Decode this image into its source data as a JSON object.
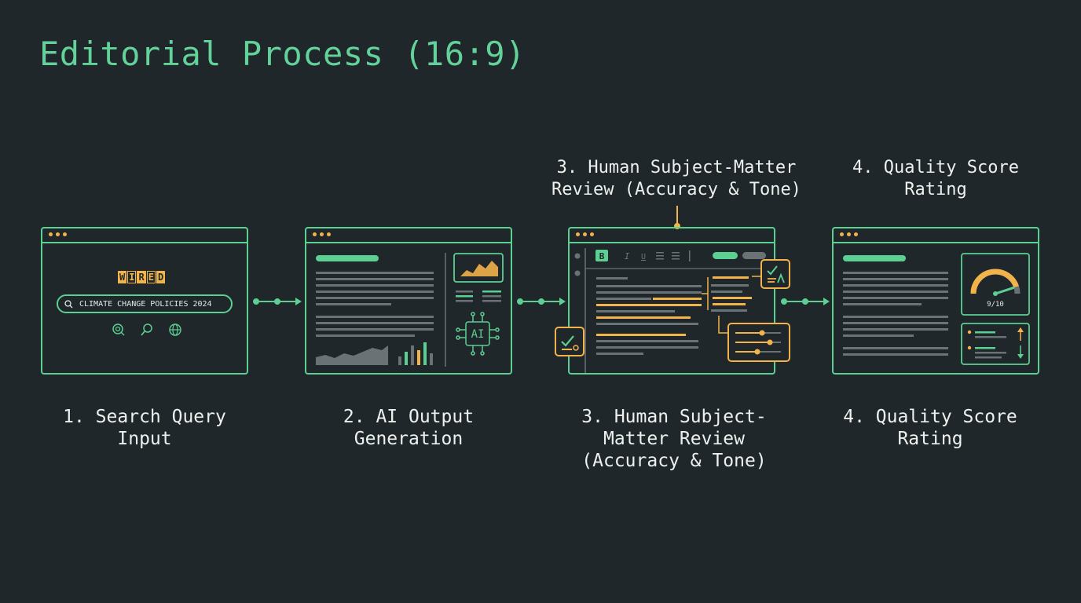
{
  "title": "Editorial Process (16:9)",
  "top_labels": {
    "step3": [
      "3. Human Subject-Matter",
      "Review (Accuracy & Tone)"
    ],
    "step4": [
      "4. Quality Score",
      "Rating"
    ]
  },
  "steps": [
    {
      "lines": [
        "1. Search Query",
        "Input"
      ]
    },
    {
      "lines": [
        "2. AI Output",
        "Generation"
      ]
    },
    {
      "lines": [
        "3. Human Subject-",
        "Matter Review",
        "(Accuracy & Tone)"
      ]
    },
    {
      "lines": [
        "4. Quality Score",
        "Rating"
      ]
    }
  ],
  "search_panel": {
    "logo_letters": [
      "W",
      "I",
      "R",
      "E",
      "D"
    ],
    "query": "CLIMATE CHANGE POLICIES 2024"
  },
  "ai_panel": {
    "chip_label": "AI"
  },
  "review_panel": {
    "bold_button": "B",
    "italic_button": "I",
    "underline_button": "U"
  },
  "quality_panel": {
    "score": "9/10",
    "score_value": 0.9
  },
  "colors": {
    "background": "#1f272b",
    "accent_green": "#5ccf93",
    "accent_orange": "#f2b34a",
    "text_gray": "#6b7275"
  },
  "icons": [
    "search-icon",
    "globe-icon",
    "chart-icon",
    "ai-chip-icon",
    "checkmark-icon",
    "sliders-icon",
    "gauge-icon",
    "arrow-up-icon",
    "arrow-down-icon"
  ]
}
